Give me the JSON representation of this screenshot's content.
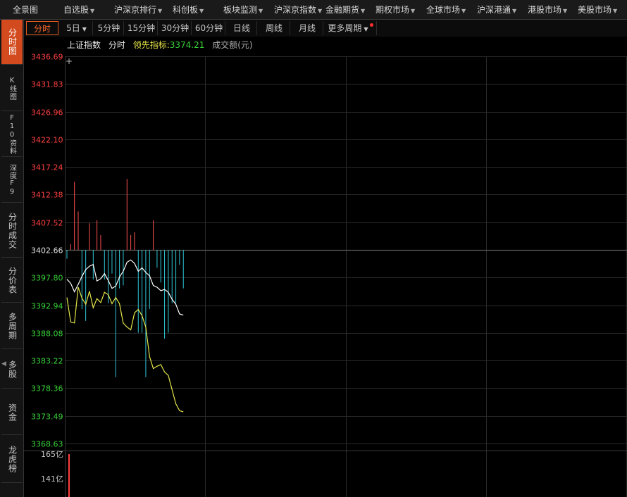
{
  "topnav": {
    "items": [
      {
        "label": "全景图",
        "dropdown": false
      },
      {
        "label": "自选股",
        "dropdown": true
      },
      {
        "label": "沪深京排行",
        "dropdown": true
      },
      {
        "label": "科创板",
        "dropdown": true
      },
      {
        "label": "板块监测",
        "dropdown": true
      },
      {
        "label": "沪深京指数",
        "dropdown": true
      },
      {
        "label": "金融期货",
        "dropdown": true
      },
      {
        "label": "期权市场",
        "dropdown": true
      },
      {
        "label": "全球市场",
        "dropdown": true
      },
      {
        "label": "沪深港通",
        "dropdown": true
      },
      {
        "label": "港股市场",
        "dropdown": true
      },
      {
        "label": "美股市场",
        "dropdown": true
      }
    ]
  },
  "sidebar": {
    "tabs": [
      {
        "label": "分时图",
        "active": true
      },
      {
        "label": "K线图",
        "active": false
      },
      {
        "label": "F10资料",
        "active": false
      },
      {
        "label": "深度F9",
        "active": false
      },
      {
        "label": "分时成交",
        "active": false
      },
      {
        "label": "分价表",
        "active": false
      },
      {
        "label": "多周期",
        "active": false
      },
      {
        "label": "多股",
        "active": false
      },
      {
        "label": "资金",
        "active": false
      },
      {
        "label": "龙虎榜",
        "active": false
      }
    ]
  },
  "periods": [
    {
      "label": "分时",
      "active": true,
      "dropdown": false
    },
    {
      "label": "5日",
      "active": false,
      "dropdown": true
    },
    {
      "label": "5分钟",
      "active": false,
      "dropdown": false
    },
    {
      "label": "15分钟",
      "active": false,
      "dropdown": false
    },
    {
      "label": "30分钟",
      "active": false,
      "dropdown": false
    },
    {
      "label": "60分钟",
      "active": false,
      "dropdown": false
    },
    {
      "label": "日线",
      "active": false,
      "dropdown": false
    },
    {
      "label": "周线",
      "active": false,
      "dropdown": false
    },
    {
      "label": "月线",
      "active": false,
      "dropdown": false
    },
    {
      "label": "更多周期",
      "active": false,
      "dropdown": true,
      "badge": true
    }
  ],
  "info": {
    "index_name": "上证指数",
    "mode": "分时",
    "leading_label": "领先指标:",
    "leading_value": "3374.21",
    "volume_label": "成交额(元)"
  },
  "colors": {
    "up": "#ff4040",
    "down": "#38d238",
    "ref": "#e0e0e0",
    "price_line": "#ffffff",
    "lead_line": "#e6e64a",
    "bar_up": "#ff5050",
    "bar_down": "#2ec8d8",
    "grid": "#2a2a2a",
    "accent": "#d34a1e"
  },
  "chart_data": {
    "type": "line",
    "previous_close": 3402.66,
    "y_ticks": [
      3436.69,
      3431.83,
      3426.96,
      3422.1,
      3417.24,
      3412.38,
      3407.52,
      3402.66,
      3397.8,
      3392.94,
      3388.08,
      3383.22,
      3378.36,
      3373.49,
      3368.63
    ],
    "ylim": [
      3368.63,
      3436.69
    ],
    "x_minutes_total": 240,
    "series": [
      {
        "key": "price",
        "values": [
          3397.5,
          3396.8,
          3395.3,
          3396.6,
          3398.0,
          3399.2,
          3399.8,
          3400.1,
          3397.2,
          3397.6,
          3398.5,
          3397.3,
          3395.9,
          3396.3,
          3397.9,
          3398.9,
          3400.5,
          3400.9,
          3400.3,
          3398.9,
          3399.5,
          3398.7,
          3398.1,
          3396.4,
          3396.1,
          3395.5,
          3395.7,
          3395.2,
          3394.0,
          3393.1,
          3391.4,
          3391.2
        ]
      },
      {
        "key": "lead",
        "values": [
          3394.3,
          3390.0,
          3389.8,
          3396.1,
          3394.2,
          3393.1,
          3395.4,
          3392.5,
          3394.1,
          3393.4,
          3395.2,
          3394.8,
          3393.2,
          3394.3,
          3393.2,
          3389.8,
          3389.1,
          3388.6,
          3391.6,
          3392.2,
          3391.1,
          3389.1,
          3383.9,
          3381.8,
          3382.2,
          3382.5,
          3381.2,
          3380.6,
          3378.1,
          3375.6,
          3374.4,
          3374.2
        ]
      }
    ],
    "bars": [
      -0.3,
      0.2,
      2.3,
      1.3,
      -2.0,
      -2.4,
      0.9,
      -1.0,
      1.0,
      0.5,
      -1.0,
      -1.8,
      -0.8,
      -4.3,
      -1.3,
      -1.2,
      2.4,
      0.5,
      0.6,
      -2.8,
      -2.8,
      -4.3,
      -2.0,
      1.0,
      -0.6,
      -1.1,
      -3.0,
      -2.8,
      -1.8,
      -1.8,
      -0.5,
      -1.3
    ],
    "volume_ticks": [
      "165亿",
      "141亿"
    ],
    "volume_values": [
      165
    ]
  }
}
